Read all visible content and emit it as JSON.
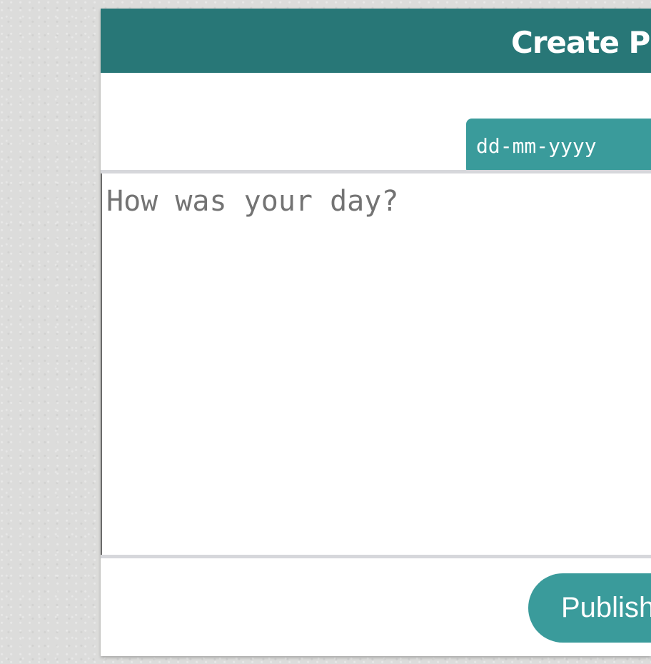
{
  "header": {
    "title": "Create P"
  },
  "form": {
    "date_placeholder": "dd-mm-yyyy",
    "entry_placeholder": "How was your day?",
    "publish_label": "Publish"
  },
  "colors": {
    "header_bg": "#287777",
    "accent": "#3a9b9b",
    "page_bg": "#dcdcdb",
    "divider": "#d6d7db"
  }
}
